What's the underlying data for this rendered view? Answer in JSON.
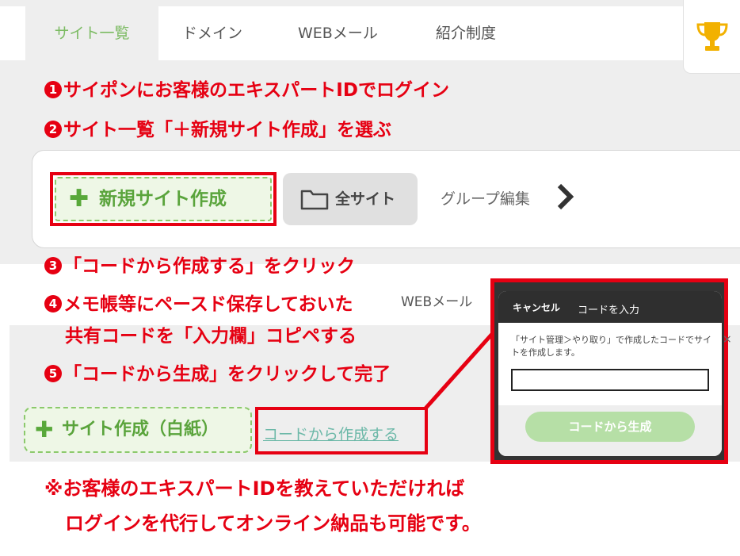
{
  "nav": {
    "tabs": [
      {
        "label": "サイト一覧"
      },
      {
        "label": "ドメイン"
      },
      {
        "label": "WEBメール"
      },
      {
        "label": "紹介制度"
      }
    ]
  },
  "steps": {
    "s1": {
      "num": "1",
      "text": "サイポンにお客様のエキスパートIDでログイン"
    },
    "s2": {
      "num": "2",
      "text": "サイト一覧「＋新規サイト作成」を選ぶ"
    },
    "s3": {
      "num": "3",
      "text": "「コードから作成する」をクリック"
    },
    "s4": {
      "num": "4",
      "text": "メモ帳等にペースド保存しておいた"
    },
    "s4b": {
      "text": "共有コードを「入力欄」コピペする"
    },
    "s5": {
      "num": "5",
      "text": "「コードから生成」をクリックして完了"
    }
  },
  "toolbar": {
    "new_site_plus": "✚",
    "new_site": "新規サイト作成",
    "all_sites": "全サイト",
    "group_edit": "グループ編集"
  },
  "second_nav": {
    "web_mail": "WEBメール"
  },
  "create": {
    "blank_plus": "✚",
    "blank": "サイト作成（白紙）",
    "from_code": "コードから作成する"
  },
  "dialog": {
    "cancel": "キャンセル",
    "title": "コードを入力",
    "description": "「サイト管理＞やり取り」で作成したコードでサイトを作成します。",
    "input_value": "",
    "input_placeholder": "",
    "generate": "コードから生成",
    "edge_char": "×"
  },
  "notes": {
    "line1": "※お客様のエキスパートIDを教えていただければ",
    "line2": "ログインを代行してオンライン納品も可能です。"
  },
  "colors": {
    "accent_red": "#e60012",
    "brand_green": "#7cbb63",
    "trophy": "#f2b100"
  },
  "icons": {
    "trophy": "trophy-icon",
    "folder": "folder-icon",
    "chevron": "chevron-right-icon",
    "plus": "plus-icon"
  }
}
